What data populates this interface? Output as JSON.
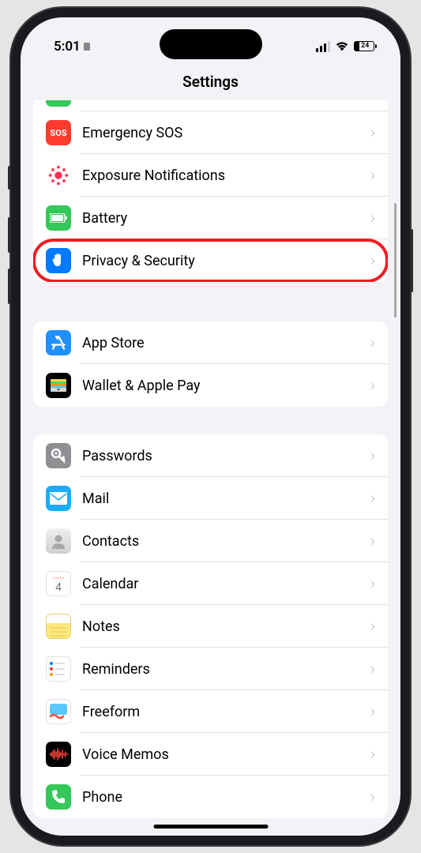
{
  "status": {
    "time": "5:01",
    "battery": "24"
  },
  "header": {
    "title": "Settings"
  },
  "groups": [
    {
      "id": "general",
      "rows": [
        {
          "id": "sos",
          "label": "Emergency SOS"
        },
        {
          "id": "exposure",
          "label": "Exposure Notifications"
        },
        {
          "id": "battery",
          "label": "Battery"
        },
        {
          "id": "privacy",
          "label": "Privacy & Security",
          "highlighted": true
        }
      ]
    },
    {
      "id": "store",
      "rows": [
        {
          "id": "appstore",
          "label": "App Store"
        },
        {
          "id": "wallet",
          "label": "Wallet & Apple Pay"
        }
      ]
    },
    {
      "id": "apps",
      "rows": [
        {
          "id": "passwords",
          "label": "Passwords"
        },
        {
          "id": "mail",
          "label": "Mail"
        },
        {
          "id": "contacts",
          "label": "Contacts"
        },
        {
          "id": "calendar",
          "label": "Calendar"
        },
        {
          "id": "notes",
          "label": "Notes"
        },
        {
          "id": "reminders",
          "label": "Reminders"
        },
        {
          "id": "freeform",
          "label": "Freeform"
        },
        {
          "id": "voicememos",
          "label": "Voice Memos"
        },
        {
          "id": "phone",
          "label": "Phone"
        }
      ]
    }
  ]
}
